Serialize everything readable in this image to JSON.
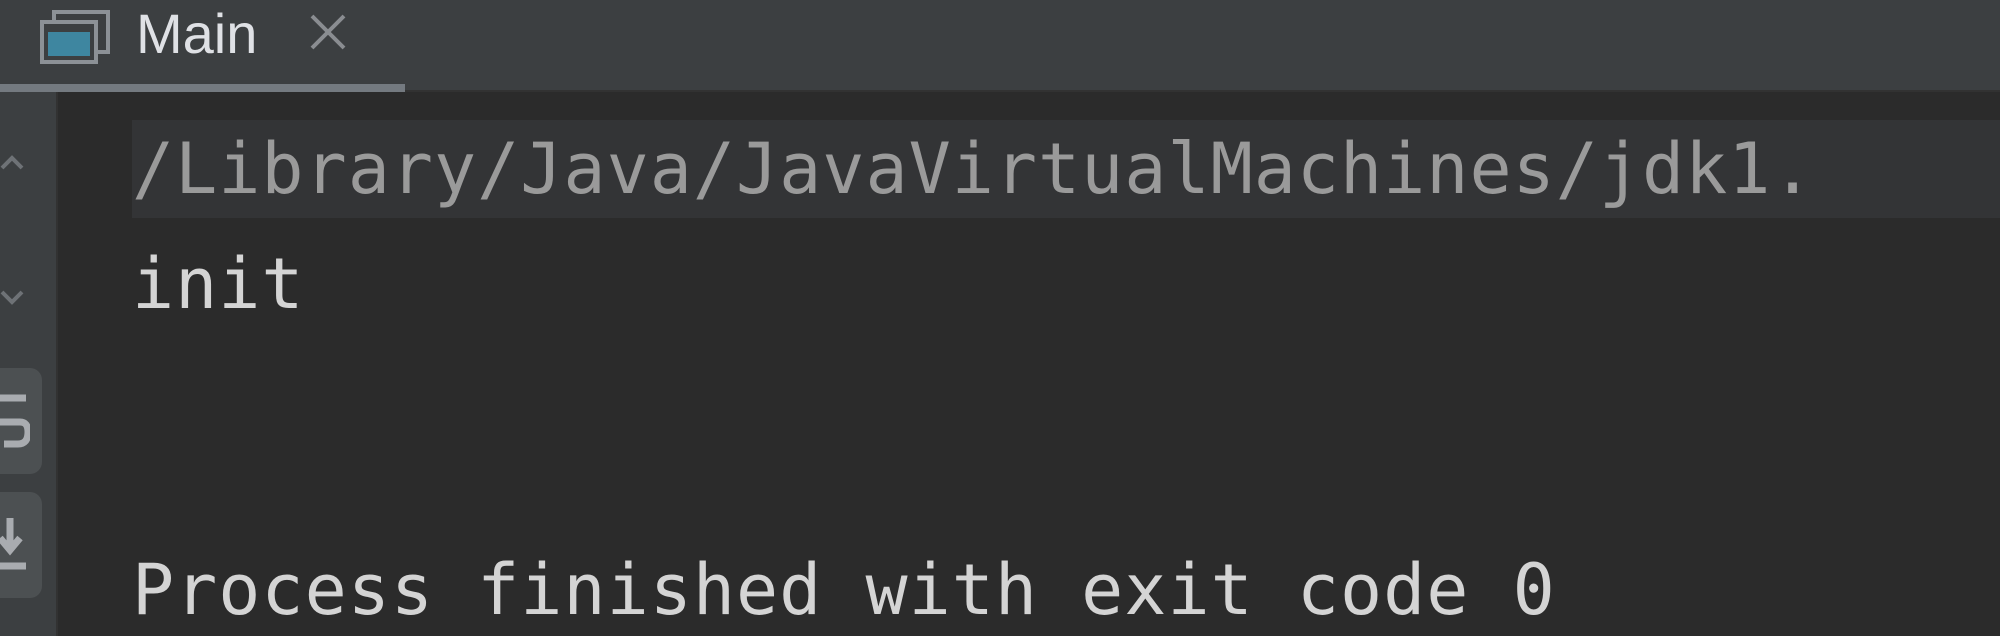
{
  "tab": {
    "title": "Main",
    "icon": "console-window-icon",
    "close_icon": "close-icon"
  },
  "gutter": {
    "buttons": [
      {
        "icon": "up-arrow-icon"
      },
      {
        "icon": "down-arrow-icon"
      },
      {
        "icon": "soft-wrap-icon"
      },
      {
        "icon": "scroll-to-end-icon"
      }
    ]
  },
  "console": {
    "command_line": "/Library/Java/JavaVirtualMachines/jdk1.",
    "output_line": "init",
    "exit_line": "Process finished with exit code 0"
  },
  "colors": {
    "background": "#2b2b2b",
    "toolbar": "#3c3f41",
    "command_highlight": "#333436",
    "text": "#d4d4d4",
    "muted_text": "#9a9a9a"
  }
}
